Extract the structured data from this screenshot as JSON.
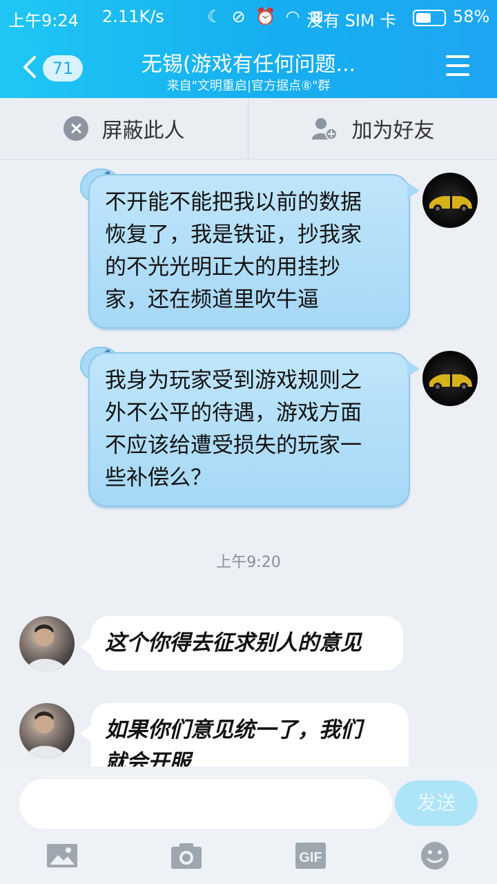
{
  "status_bar": {
    "time": "上午9:24",
    "speed": "2.11K/s",
    "sim_text": "没有 SIM 卡",
    "battery": "58%",
    "battery_level": 0.58
  },
  "header": {
    "back_badge": "71",
    "title": "无锡(游戏有任何问题...",
    "subtitle": "来自\"文明重启|官方据点⑧\"群"
  },
  "actions": {
    "block": "屏蔽此人",
    "add_friend": "加为好友"
  },
  "messages": {
    "sent_1": [
      "不开能不能把我以前的数据",
      "恢复了，我是铁证，抄我家",
      "的不光光明正大的用挂抄",
      "家，还在频道里吹牛逼"
    ],
    "sent_2": [
      "我身为玩家受到游戏规则之",
      "外不公平的待遇，游戏方面",
      "不应该给遭受损失的玩家一",
      "些补偿么？"
    ],
    "timestamp": "上午9:20",
    "recv_1": "这个你得去征求别人的意见",
    "recv_2": [
      "如果你们意见统一了，我们",
      "就会开服"
    ]
  },
  "input": {
    "placeholder": "",
    "send_label": "发送",
    "tools": [
      "image-icon",
      "camera-icon",
      "gif-icon",
      "emoji-icon"
    ]
  }
}
